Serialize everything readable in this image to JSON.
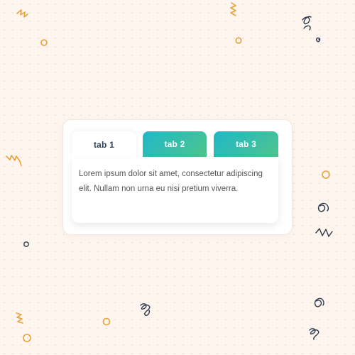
{
  "tabs": [
    {
      "label": "tab 1",
      "active": true
    },
    {
      "label": "tab 2",
      "active": false
    },
    {
      "label": "tab 3",
      "active": false
    }
  ],
  "panel": {
    "text": "Lorem ipsum dolor sit amet, consectetur adipiscing elit. Nullam non urna eu nisi pretium viverra."
  },
  "colors": {
    "background": "#fdf5ee",
    "tab_gradient_start": "#1fb8c9",
    "tab_gradient_end": "#4ec48c",
    "active_tab_text": "#2e4356",
    "body_text": "#555555",
    "confetti_orange": "#e9a13b",
    "confetti_navy": "#2e3a4f"
  }
}
